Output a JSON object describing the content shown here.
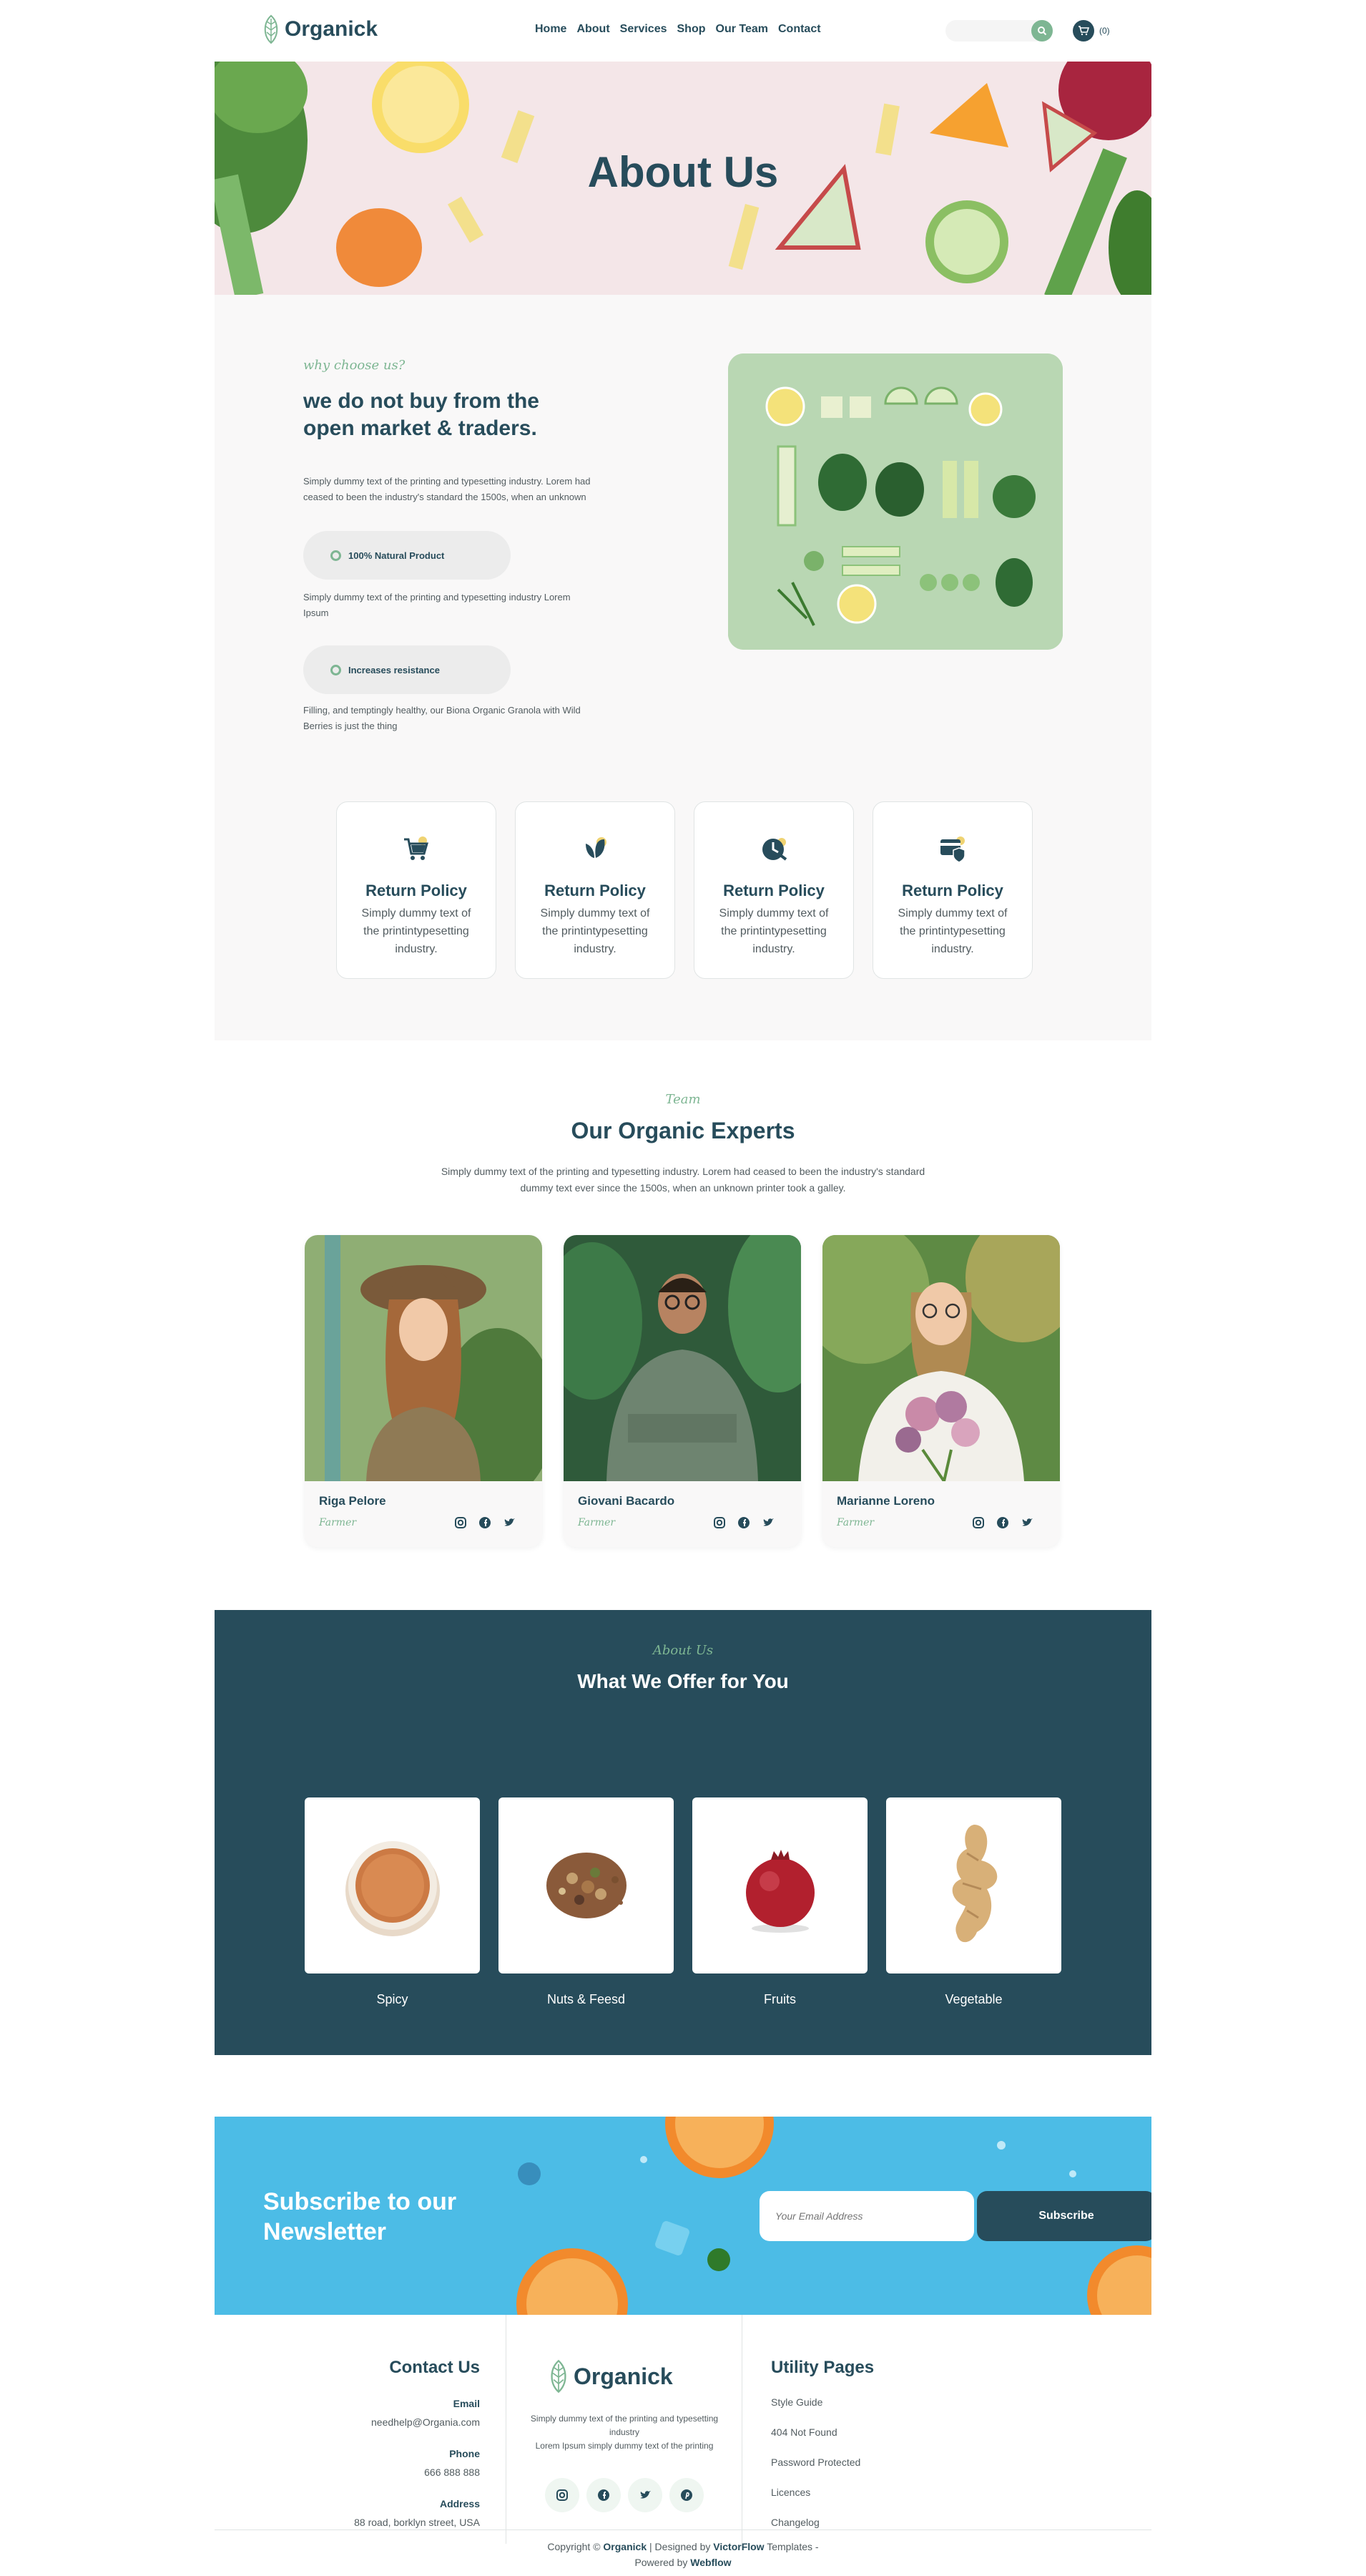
{
  "nav": {
    "logo": "Organick",
    "menu": [
      "Home",
      "About",
      "Services",
      "Shop",
      "Our Team",
      "Contact"
    ],
    "cart_count": "(0)"
  },
  "hero": {
    "title": "About Us"
  },
  "why": {
    "kicker": "why choose us?",
    "title": "we do not buy from the open market & traders.",
    "intro": "Simply dummy text of the printing and typesetting industry. Lorem had ceased to been the industry's standard the 1500s, when an unknown",
    "points": [
      {
        "label": "100% Natural Product",
        "text": "Simply dummy text of the printing and typesetting industry Lorem Ipsum"
      },
      {
        "label": "Increases resistance",
        "text": "Filling, and temptingly healthy, our Biona Organic Granola with Wild Berries is just the thing"
      }
    ]
  },
  "features": [
    {
      "icon": "cart-icon",
      "title": "Return Policy",
      "text": "Simply dummy text of the printintypesetting industry."
    },
    {
      "icon": "leaf-icon",
      "title": "Return Policy",
      "text": "Simply dummy text of the printintypesetting industry."
    },
    {
      "icon": "clock-icon",
      "title": "Return Policy",
      "text": "Simply dummy text of the printintypesetting industry."
    },
    {
      "icon": "shield-card-icon",
      "title": "Return Policy",
      "text": "Simply dummy text of the printintypesetting industry."
    }
  ],
  "team": {
    "kicker": "Team",
    "title": "Our Organic Experts",
    "desc": "Simply dummy text of the printing and typesetting industry. Lorem had ceased to been the industry's standard dummy text ever since the 1500s, when an unknown printer took a galley.",
    "members": [
      {
        "name": "Riga Pelore",
        "role": "Farmer"
      },
      {
        "name": "Giovani Bacardo",
        "role": "Farmer"
      },
      {
        "name": "Marianne Loreno",
        "role": "Farmer"
      }
    ]
  },
  "offer": {
    "kicker": "About Us",
    "title": "What We Offer for You",
    "items": [
      "Spicy",
      "Nuts & Feesd",
      "Fruits",
      "Vegetable"
    ]
  },
  "newsletter": {
    "title": "Subscribe to our Newsletter",
    "placeholder": "Your Email Address",
    "button": "Subscribe"
  },
  "footer": {
    "contact_title": "Contact Us",
    "email_label": "Email",
    "email": "needhelp@Organia.com",
    "phone_label": "Phone",
    "phone": "666 888 888",
    "address_label": "Address",
    "address": "88 road, borklyn street, USA",
    "logo": "Organick",
    "desc1": "Simply dummy text of the printing and typesetting industry",
    "desc2": "Lorem Ipsum simply dummy text of the printing",
    "utility_title": "Utility Pages",
    "utility": [
      "Style Guide",
      "404 Not Found",
      "Password Protected",
      "Licences",
      "Changelog"
    ],
    "copy_prefix": "Copyright © ",
    "copy_brand": "Organick",
    "copy_mid": " | Designed by ",
    "copy_designer": "VictorFlow",
    "copy_suffix": " Templates -",
    "powered_prefix": "Powered by ",
    "powered_by": "Webflow"
  },
  "colors": {
    "primary": "#274c5b",
    "accent": "#7eb693",
    "yellow": "#efd372",
    "sky": "#4cbce6"
  }
}
